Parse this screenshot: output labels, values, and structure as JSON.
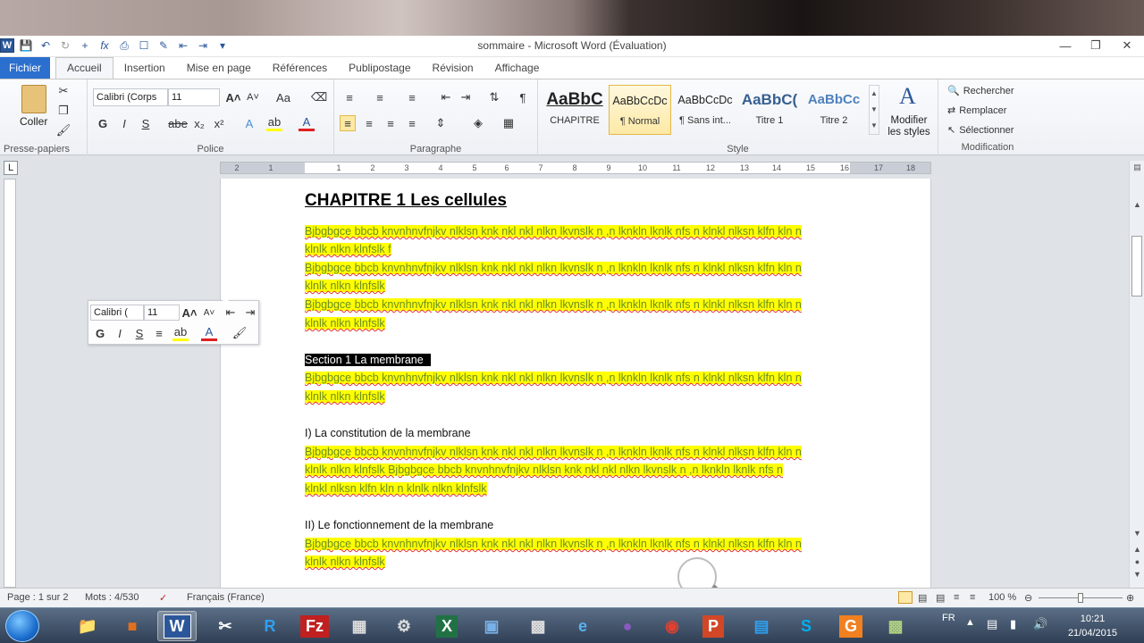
{
  "window": {
    "title": "sommaire - Microsoft Word (Évaluation)"
  },
  "tabs": [
    "Fichier",
    "Accueil",
    "Insertion",
    "Mise en page",
    "Références",
    "Publipostage",
    "Révision",
    "Affichage"
  ],
  "ribbon": {
    "clipboard": {
      "paste_label": "Coller",
      "group_label": "Presse-papiers"
    },
    "font": {
      "name": "Calibri (Corps",
      "size": "11",
      "group_label": "Police",
      "bold": "G",
      "italic": "I",
      "underline": "S"
    },
    "paragraph": {
      "group_label": "Paragraphe"
    },
    "styles": {
      "group_label": "Style",
      "items": [
        {
          "preview": "AaBbC",
          "name": "CHAPITRE"
        },
        {
          "preview": "AaBbCcDc",
          "name": "¶ Normal"
        },
        {
          "preview": "AaBbCcDc",
          "name": "¶ Sans int..."
        },
        {
          "preview": "AaBbC(",
          "name": "Titre 1"
        },
        {
          "preview": "AaBbCc",
          "name": "Titre 2"
        }
      ],
      "modify_label_1": "Modifier",
      "modify_label_2": "les styles"
    },
    "editing": {
      "group_label": "Modification",
      "find": "Rechercher",
      "replace": "Remplacer",
      "select": "Sélectionner"
    }
  },
  "ruler_ticks": [
    "2",
    "1",
    "1",
    "2",
    "3",
    "4",
    "5",
    "6",
    "7",
    "8",
    "9",
    "10",
    "11",
    "12",
    "13",
    "14",
    "15",
    "16",
    "17",
    "18"
  ],
  "mini_toolbar": {
    "font": "Calibri (",
    "size": "11",
    "bold": "G",
    "italic": "I",
    "underline": "S"
  },
  "document": {
    "chapter": "CHAPITRE 1 Les cellules",
    "filler_a": "Bjbgbgce bbcb knvnhnvfnjkv nlklsn knk nkl nkl nlkn lkvnslk n ,n lknkln lknlk  nfs n klnkl nlksn klfn kln  n",
    "filler_b1": "klnlk nlkn klnfslk f",
    "filler_b": "klnlk nlkn klnfslk",
    "section1": "Section 1 La membrane",
    "heading_i": "I) La constitution de la membrane",
    "mixed_b": "klnlk nlkn klnfslk Bjbgbgce bbcb knvnhnvfnjkv nlklsn knk nkl nkl nlkn lkvnslk n ,n lknkln lknlk nfs n",
    "mixed_c": "klnkl nlksn klfn kln  n klnlk nlkn klnfslk",
    "heading_ii": "II) Le fonctionnement de la membrane"
  },
  "status": {
    "page": "Page : 1 sur 2",
    "words": "Mots : 4/530",
    "language": "Français (France)",
    "zoom": "100 %"
  },
  "taskbar": {
    "lang": "FR",
    "time": "10:21",
    "date": "21/04/2015"
  }
}
